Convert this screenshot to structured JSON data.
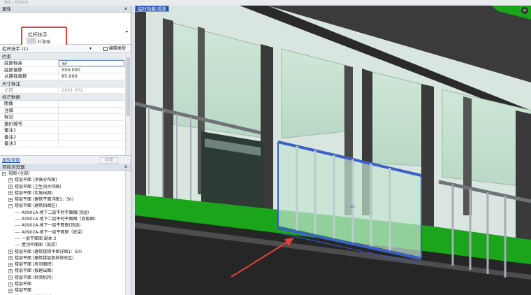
{
  "window": {
    "title": "修改 | 栏杆扶手"
  },
  "properties": {
    "header": "属性",
    "type_selector": {
      "line1": "栏杆扶手",
      "line2": "栏玻璃"
    },
    "instance_label": "栏杆扶手 (1)",
    "edit_type_label": "编辑类型",
    "sections": [
      {
        "title": "约束",
        "rows": [
          {
            "key": "底部标高",
            "value": "6F",
            "selected": true
          },
          {
            "key": "底部偏移",
            "value": "550.000"
          },
          {
            "key": "从路径偏移",
            "value": "85.000"
          }
        ]
      },
      {
        "title": "尺寸标注",
        "rows": [
          {
            "key": "长度",
            "value": "2801.062",
            "disabled": true
          }
        ]
      },
      {
        "title": "标识数据",
        "rows": [
          {
            "key": "图像",
            "value": ""
          },
          {
            "key": "注释",
            "value": ""
          },
          {
            "key": "标记",
            "value": ""
          },
          {
            "key": "报价编号",
            "value": ""
          },
          {
            "key": "备注1",
            "value": ""
          },
          {
            "key": "备注2",
            "value": ""
          },
          {
            "key": "备注3",
            "value": ""
          }
        ]
      }
    ],
    "help_link": "属性帮助",
    "apply_label": "应用"
  },
  "project_browser": {
    "header": "项目浏览器",
    "items": [
      {
        "level": 0,
        "exp": "−",
        "label": "视图 (全部)"
      },
      {
        "level": 1,
        "exp": "+",
        "label": "楼层平面 (净高分布图)"
      },
      {
        "level": 1,
        "exp": "+",
        "label": "楼层平面 (卫生间大样图)"
      },
      {
        "level": 1,
        "exp": "+",
        "label": "楼层平面 (实施出图)"
      },
      {
        "level": 1,
        "exp": "+",
        "label": "楼层平面 (建筑平面详图1：50)"
      },
      {
        "level": 1,
        "exp": "−",
        "label": "楼层平面 (建筑拍图区)"
      },
      {
        "level": 2,
        "exp": "",
        "label": "A0901A-地下二层平时平面图(顶涵)"
      },
      {
        "level": 2,
        "exp": "",
        "label": "A0901A-地下二层平时平面图（底板图）"
      },
      {
        "level": 2,
        "exp": "",
        "label": "A0902A-地下一层平面图(顶涵)"
      },
      {
        "level": 2,
        "exp": "",
        "label": "A0902A-地下一层平面图（底梁）"
      },
      {
        "level": 2,
        "exp": "",
        "label": "一层平面图 副本 2"
      },
      {
        "level": 2,
        "exp": "",
        "label": "屋顶平面图（底梁）"
      },
      {
        "level": 1,
        "exp": "+",
        "label": "楼层平面 (建筑楼梯平面详图1：50)"
      },
      {
        "level": 1,
        "exp": "+",
        "label": "楼层平面 (建筑楼层复核修改区)"
      },
      {
        "level": 1,
        "exp": "+",
        "label": "楼层平面 (房间面积)"
      },
      {
        "level": 1,
        "exp": "+",
        "label": "楼层平面 (报建出图)"
      },
      {
        "level": 1,
        "exp": "+",
        "label": "楼层平面 (检验机构)"
      },
      {
        "level": 1,
        "exp": "+",
        "label": "楼层平面"
      },
      {
        "level": 1,
        "exp": "+",
        "label": "楼层平面"
      },
      {
        "level": 1,
        "exp": "+",
        "label": "楼层平面 (楼梯大样-FJZ)"
      }
    ]
  },
  "viewport": {
    "label": "临时隐藏/隔离"
  },
  "colors": {
    "accent_red": "#e0433a",
    "selection_blue": "#1f4fa8",
    "floor_green": "#1aa51a"
  }
}
